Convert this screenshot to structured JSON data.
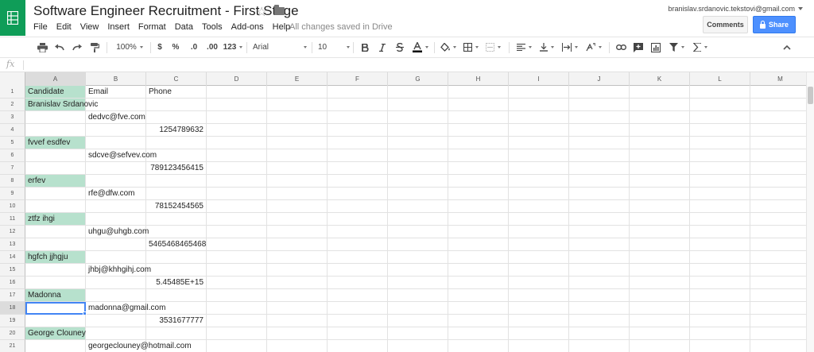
{
  "header": {
    "title": "Software Engineer Recruitment - First Stage",
    "account_email": "branislav.srdanovic.tekstovi@gmail.com",
    "save_status": "All changes saved in Drive",
    "comments_label": "Comments",
    "share_label": "Share"
  },
  "menu": [
    "File",
    "Edit",
    "View",
    "Insert",
    "Format",
    "Data",
    "Tools",
    "Add-ons",
    "Help"
  ],
  "toolbar": {
    "zoom": "100%",
    "currency": "$",
    "percent": "%",
    "decrease_decimals": ".0",
    "increase_decimals": ".00",
    "more_formats": "123",
    "font": "Arial",
    "font_size": "10"
  },
  "formula_bar": {
    "icon": "fx",
    "value": ""
  },
  "columns": [
    "A",
    "B",
    "C",
    "D",
    "E",
    "F",
    "G",
    "H",
    "I",
    "J",
    "K",
    "L",
    "M"
  ],
  "selected": {
    "column": "A",
    "row": "18"
  },
  "rows": [
    {
      "num": "1",
      "a": "Candidate",
      "b": "Email",
      "c": "Phone",
      "a_hl": true
    },
    {
      "num": "2",
      "a": "Branislav Srdanovic",
      "b": "",
      "c": "",
      "a_hl": true
    },
    {
      "num": "3",
      "a": "",
      "b": "dedvc@fve.com",
      "c": ""
    },
    {
      "num": "4",
      "a": "",
      "b": "",
      "c": "1254789632"
    },
    {
      "num": "5",
      "a": "fvvef esdfev",
      "b": "",
      "c": "",
      "a_hl": true
    },
    {
      "num": "6",
      "a": "",
      "b": "sdcve@sefvev.com",
      "c": ""
    },
    {
      "num": "7",
      "a": "",
      "b": "",
      "c": "789123456415"
    },
    {
      "num": "8",
      "a": "erfev",
      "b": "",
      "c": "",
      "a_hl": true
    },
    {
      "num": "9",
      "a": "",
      "b": "rfe@dfw.com",
      "c": ""
    },
    {
      "num": "10",
      "a": "",
      "b": "",
      "c": "78152454565"
    },
    {
      "num": "11",
      "a": "ztfz ihgi",
      "b": "",
      "c": "",
      "a_hl": true
    },
    {
      "num": "12",
      "a": "",
      "b": "uhgu@uhgb.com",
      "c": ""
    },
    {
      "num": "13",
      "a": "",
      "b": "",
      "c": "5465468465468"
    },
    {
      "num": "14",
      "a": "hgfch jjhgju",
      "b": "",
      "c": "",
      "a_hl": true
    },
    {
      "num": "15",
      "a": "",
      "b": "jhbj@khhgihj.com",
      "c": ""
    },
    {
      "num": "16",
      "a": "",
      "b": "",
      "c": "5.45485E+15"
    },
    {
      "num": "17",
      "a": "Madonna",
      "b": "",
      "c": "",
      "a_hl": true
    },
    {
      "num": "18",
      "a": "",
      "b": "madonna@gmail.com",
      "c": "",
      "a_active": true
    },
    {
      "num": "19",
      "a": "",
      "b": "",
      "c": "3531677777"
    },
    {
      "num": "20",
      "a": "George Clouney",
      "b": "",
      "c": "",
      "a_hl": true
    },
    {
      "num": "21",
      "a": "",
      "b": "georgeclouney@hotmail.com",
      "c": ""
    }
  ]
}
